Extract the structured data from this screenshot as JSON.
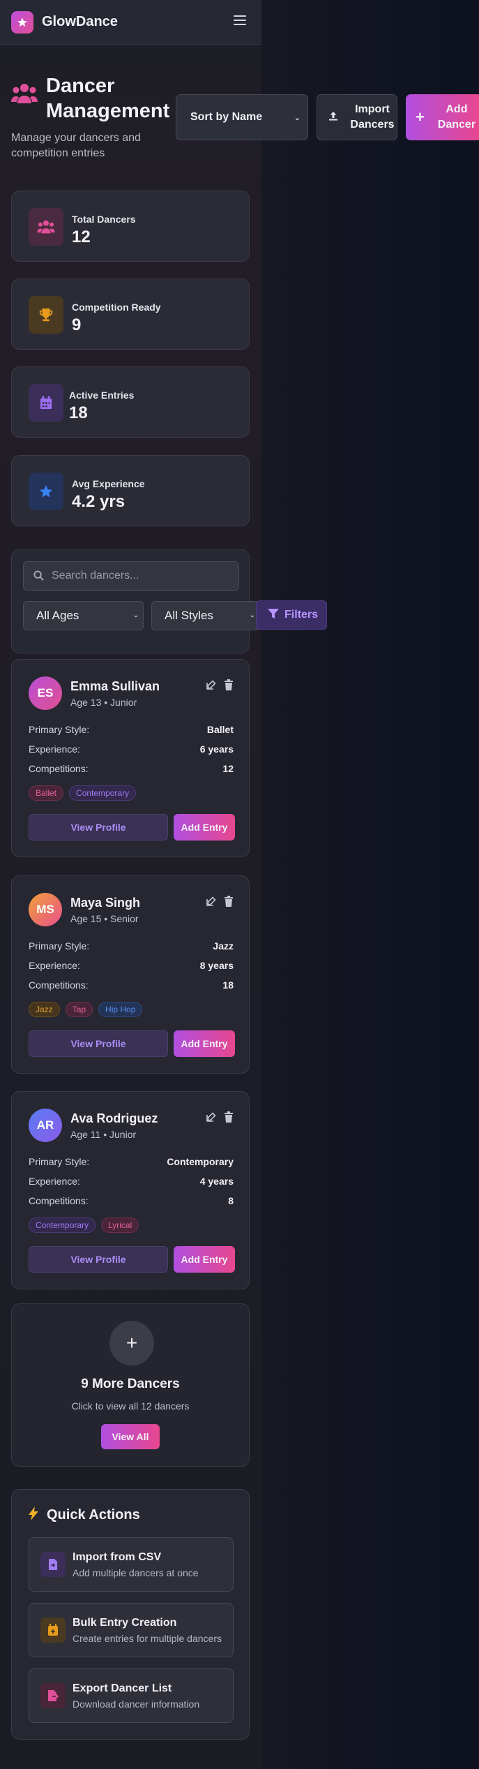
{
  "app": {
    "brand": "GlowDance"
  },
  "page": {
    "title": "Dancer Management",
    "subtitle": "Manage your dancers and competition entries"
  },
  "toolbar": {
    "sort_label": "Sort by Name",
    "import_label": "Import Dancers",
    "add_label": "Add Dancer"
  },
  "stats": [
    {
      "label": "Total Dancers",
      "value": "12",
      "icon": "users-icon"
    },
    {
      "label": "Competition Ready",
      "value": "9",
      "icon": "trophy-icon"
    },
    {
      "label": "Active Entries",
      "value": "18",
      "icon": "calendar-icon"
    },
    {
      "label": "Avg Experience",
      "value": "4.2 yrs",
      "icon": "star-icon"
    }
  ],
  "filters": {
    "search_placeholder": "Search dancers...",
    "ages_value": "All Ages",
    "styles_value": "All Styles",
    "filters_label": "Filters"
  },
  "labels": {
    "primary_style": "Primary Style:",
    "experience": "Experience:",
    "competitions": "Competitions:",
    "view_profile": "View Profile",
    "add_entry": "Add Entry"
  },
  "dancers": [
    {
      "initials": "ES",
      "name": "Emma Sullivan",
      "meta": "Age 13 • Junior",
      "style": "Ballet",
      "experience": "6 years",
      "competitions": "12",
      "tags": [
        "Ballet",
        "Contemporary"
      ]
    },
    {
      "initials": "MS",
      "name": "Maya Singh",
      "meta": "Age 15 • Senior",
      "style": "Jazz",
      "experience": "8 years",
      "competitions": "18",
      "tags": [
        "Jazz",
        "Tap",
        "Hip Hop"
      ]
    },
    {
      "initials": "AR",
      "name": "Ava Rodriguez",
      "meta": "Age 11 • Junior",
      "style": "Contemporary",
      "experience": "4 years",
      "competitions": "8",
      "tags": [
        "Contemporary",
        "Lyrical"
      ]
    }
  ],
  "more": {
    "title": "9 More Dancers",
    "subtitle": "Click to view all 12 dancers",
    "button": "View All"
  },
  "quick_actions": {
    "title": "Quick Actions",
    "items": [
      {
        "title": "Import from CSV",
        "subtitle": "Add multiple dancers at once",
        "icon": "file-import-icon"
      },
      {
        "title": "Bulk Entry Creation",
        "subtitle": "Create entries for multiple dancers",
        "icon": "calendar-plus-icon"
      },
      {
        "title": "Export Dancer List",
        "subtitle": "Download dancer information",
        "icon": "file-export-icon"
      }
    ]
  },
  "colors": {
    "accent_gradient_start": "#b14fe0",
    "accent_gradient_end": "#e8478f",
    "background": "#1c1d26"
  }
}
